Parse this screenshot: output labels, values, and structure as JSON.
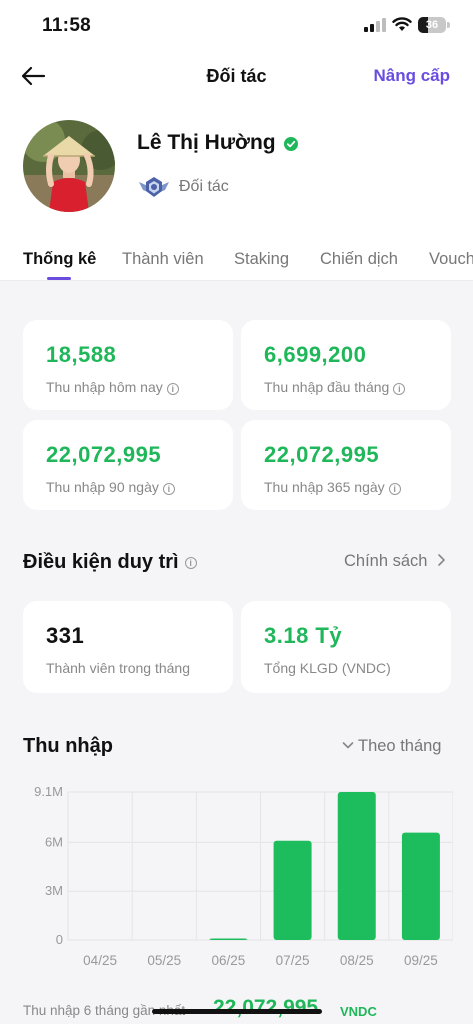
{
  "status_bar": {
    "time": "11:58",
    "battery": "36",
    "battery_fraction": 0.36
  },
  "nav": {
    "title": "Đối tác",
    "upgrade": "Nâng cấp"
  },
  "profile": {
    "name": "Lê Thị Hường",
    "role": "Đối tác"
  },
  "tabs": [
    "Thống kê",
    "Thành viên",
    "Staking",
    "Chiến dịch",
    "Vouch"
  ],
  "stats": [
    {
      "value": "18,588",
      "label": "Thu nhập hôm nay"
    },
    {
      "value": "6,699,200",
      "label": "Thu nhập đầu tháng"
    },
    {
      "value": "22,072,995",
      "label": "Thu nhập 90 ngày"
    },
    {
      "value": "22,072,995",
      "label": "Thu nhập 365 ngày"
    }
  ],
  "conditions": {
    "title": "Điều kiện duy trì",
    "link": "Chính sách",
    "items": [
      {
        "value": "331",
        "label": "Thành viên trong tháng"
      },
      {
        "value": "3.18 Tỷ",
        "label": "Tổng KLGD (VNDC)"
      }
    ]
  },
  "income": {
    "title": "Thu nhập",
    "filter": "Theo tháng",
    "footer_label": "Thu nhập 6 tháng gần nhất",
    "footer_total": "22,072,995",
    "footer_unit": "VNDC"
  },
  "colors": {
    "accent": "#6a4de0",
    "green": "#1fb75a",
    "bar": "#1dbd5e"
  },
  "chart_data": {
    "type": "bar",
    "categories": [
      "04/25",
      "05/25",
      "06/25",
      "07/25",
      "08/25",
      "09/25"
    ],
    "values": [
      0,
      0,
      0.05,
      6.1,
      9.1,
      6.6
    ],
    "yticks": [
      "0",
      "3M",
      "6M",
      "9.1M"
    ],
    "ytick_values": [
      0,
      3,
      6,
      9.1
    ],
    "ylim": [
      0,
      9.1
    ],
    "unit": "M",
    "grid": true
  }
}
